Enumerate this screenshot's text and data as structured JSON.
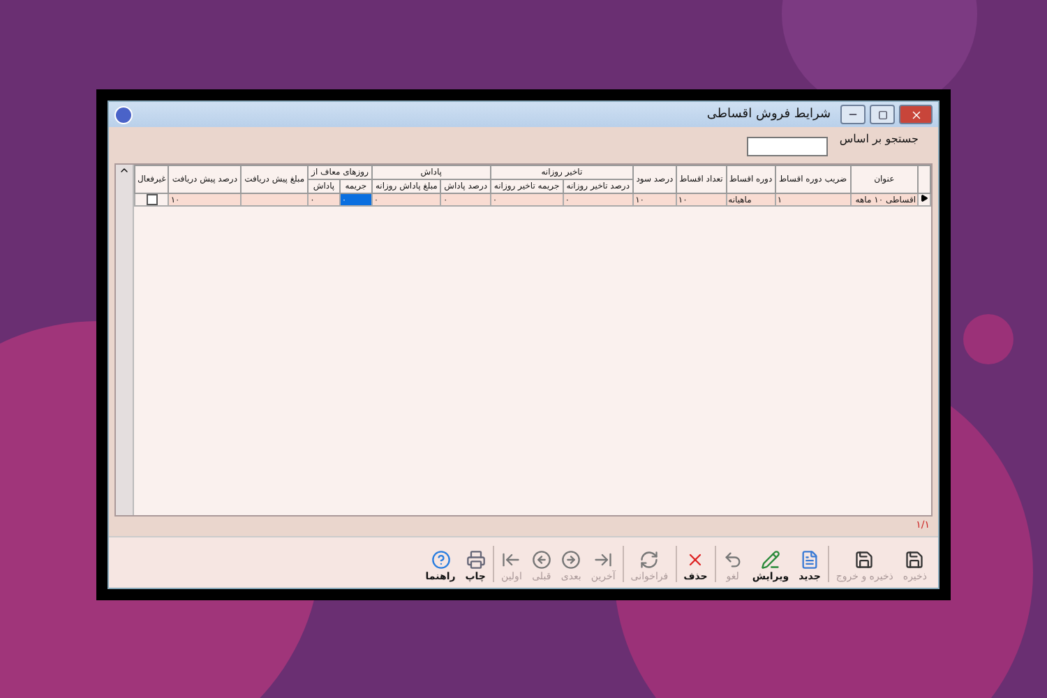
{
  "window": {
    "title": "شرایط فروش اقساطی"
  },
  "search": {
    "label": "جستجو بر اساس"
  },
  "table": {
    "columns": [
      {
        "label": "عنوان"
      },
      {
        "label": "ضریب دوره اقساط"
      },
      {
        "label": "دوره اقساط"
      },
      {
        "label": "تعداد اقساط"
      },
      {
        "label": "درصد سود"
      },
      {
        "label": "تاخیر روزانه",
        "colspan": 2,
        "children": [
          {
            "label": "درصد تاخیر روزانه"
          },
          {
            "label": "جریمه تاخیر روزانه"
          }
        ]
      },
      {
        "label": "پاداش",
        "colspan": 2,
        "children": [
          {
            "label": "درصد پاداش"
          },
          {
            "label": "مبلغ پاداش روزانه"
          }
        ]
      },
      {
        "label": "روزهای معاف از",
        "colspan": 2,
        "children": [
          {
            "label": "جریمه"
          },
          {
            "label": "پاداش"
          }
        ]
      },
      {
        "label": "مبلغ پیش دریافت"
      },
      {
        "label": "درصد پیش دریافت"
      },
      {
        "label": "غیرفعال"
      }
    ],
    "rows": [
      {
        "current": true,
        "inactive": false,
        "cells": [
          {
            "text": "اقساطی ۱۰ ماهه",
            "selected": false
          },
          {
            "text": "۱",
            "selected": false
          },
          {
            "text": "ماهیانه",
            "selected": false
          },
          {
            "text": "۱۰",
            "selected": false
          },
          {
            "text": "۱۰",
            "selected": false
          },
          {
            "text": "۰",
            "selected": false
          },
          {
            "text": "۰",
            "selected": false
          },
          {
            "text": "۰",
            "selected": false
          },
          {
            "text": "۰",
            "selected": false
          },
          {
            "text": "۰",
            "selected": true
          },
          {
            "text": "۰",
            "selected": false
          },
          {
            "text": "",
            "selected": false
          },
          {
            "text": "۱۰",
            "selected": false
          }
        ]
      }
    ]
  },
  "status": "۱/۱",
  "toolbar": [
    {
      "kind": "save",
      "label": "ذخیره",
      "disabled": true
    },
    {
      "kind": "save",
      "label": "ذخیره و خروج",
      "disabled": true
    },
    {
      "kind": "sep"
    },
    {
      "kind": "new",
      "label": "جدید",
      "disabled": false
    },
    {
      "kind": "edit",
      "label": "ویرایش",
      "disabled": false
    },
    {
      "kind": "cancel",
      "label": "لغو",
      "disabled": true
    },
    {
      "kind": "sep"
    },
    {
      "kind": "delete",
      "label": "حذف",
      "disabled": false
    },
    {
      "kind": "sep"
    },
    {
      "kind": "reload",
      "label": "فراخوانی",
      "disabled": true
    },
    {
      "kind": "sep"
    },
    {
      "kind": "last",
      "label": "آخرین",
      "disabled": true
    },
    {
      "kind": "next",
      "label": "بعدی",
      "disabled": true
    },
    {
      "kind": "prev",
      "label": "قبلی",
      "disabled": true
    },
    {
      "kind": "first",
      "label": "اولین",
      "disabled": true
    },
    {
      "kind": "sep"
    },
    {
      "kind": "print",
      "label": "چاپ",
      "disabled": false
    },
    {
      "kind": "help",
      "label": "راهنما",
      "disabled": false
    }
  ]
}
